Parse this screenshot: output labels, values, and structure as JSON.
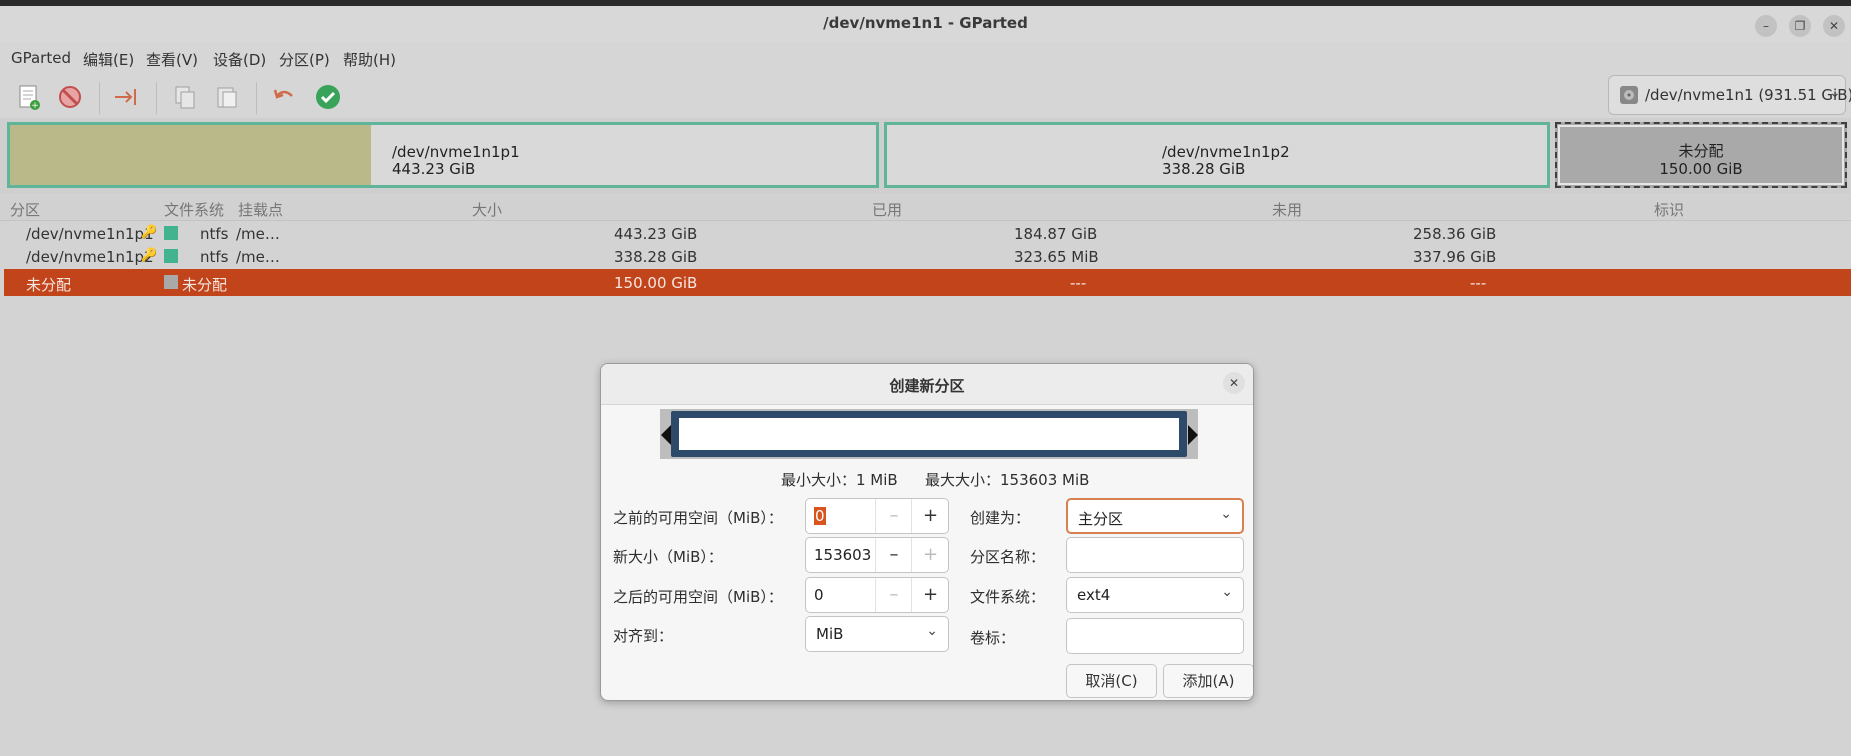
{
  "window": {
    "title": "/dev/nvme1n1 - GParted"
  },
  "menu": [
    "GParted",
    "编辑(E)",
    "查看(V)",
    "设备(D)",
    "分区(P)",
    "帮助(H)"
  ],
  "toolbar": {
    "icons": [
      "new-partition-icon",
      "delete-icon",
      "resize-move-icon",
      "copy-icon",
      "paste-icon",
      "undo-icon",
      "apply-icon"
    ],
    "device_select": "/dev/nvme1n1 (931.51 GiB)"
  },
  "disk_map": [
    {
      "name": "/dev/nvme1n1p1",
      "size": "443.23 GiB",
      "used_fraction": 0.417
    },
    {
      "name": "/dev/nvme1n1p2",
      "size": "338.28 GiB",
      "used_fraction": 0.001
    },
    {
      "name": "未分配",
      "size": "150.00 GiB"
    }
  ],
  "table": {
    "headers": [
      "分区",
      "文件系统",
      "挂载点",
      "大小",
      "已用",
      "未用",
      "标识"
    ],
    "rows": [
      {
        "partition": "/dev/nvme1n1p1",
        "fs": "ntfs",
        "mount": "/me…",
        "size": "443.23 GiB",
        "used": "184.87 GiB",
        "unused": "258.36 GiB",
        "flags": ""
      },
      {
        "partition": "/dev/nvme1n1p2",
        "fs": "ntfs",
        "mount": "/me…",
        "size": "338.28 GiB",
        "used": "323.65 MiB",
        "unused": "337.96 GiB",
        "flags": ""
      },
      {
        "partition": "未分配",
        "fs": "未分配",
        "mount": "",
        "size": "150.00 GiB",
        "used": "---",
        "unused": "---",
        "flags": ""
      }
    ]
  },
  "dialog": {
    "title": "创建新分区",
    "min_size": "最小大小：1 MiB",
    "max_size": "最大大小：153603 MiB",
    "free_before_label": "之前的可用空间（MiB）：",
    "free_before_value": "0",
    "new_size_label": "新大小（MiB）：",
    "new_size_value": "153603",
    "free_after_label": "之后的可用空间（MiB）：",
    "free_after_value": "0",
    "align_label": "对齐到：",
    "align_value": "MiB",
    "create_as_label": "创建为：",
    "create_as_value": "主分区",
    "part_name_label": "分区名称：",
    "part_name_value": "",
    "fs_label": "文件系统：",
    "fs_value": "ext4",
    "volume_label_label": "卷标：",
    "volume_label_value": "",
    "cancel_button": "取消(C)",
    "add_button": "添加(A)"
  },
  "colors": {
    "ntfs": "#42b38e",
    "unallocated": "#a9a9a9",
    "selected_row": "#c2441b",
    "partition_border": "#5fb49a"
  }
}
